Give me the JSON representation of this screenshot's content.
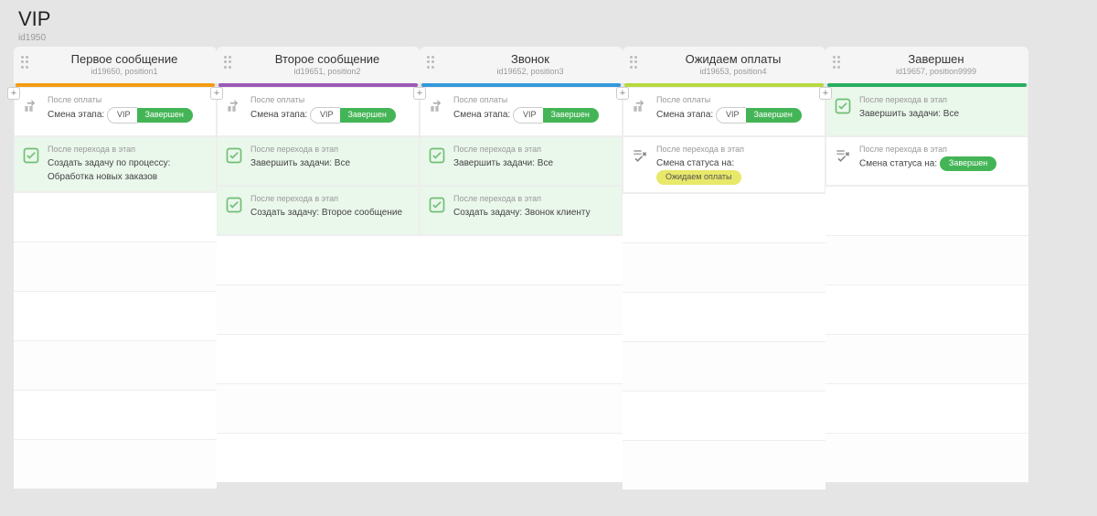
{
  "header": {
    "title": "VIP",
    "subtitle": "id1950"
  },
  "triggers": {
    "afterPay": "После оплаты",
    "afterStage": "После перехода в этап"
  },
  "labels": {
    "stageChange": "Смена этапа:",
    "createTaskProcess": "Создать задачу по процессу:",
    "completeTasks": "Завершить задачи:",
    "createTask": "Создать задачу:",
    "statusChange": "Смена статуса на:"
  },
  "pills": {
    "vip": "VIP",
    "done": "Завершен",
    "waiting": "Ожидаем оплаты"
  },
  "values": {
    "all": "Все",
    "processOrders": "Обработка новых заказов",
    "secondMsg": "Второе сообщение",
    "callClient": "Звонок клиенту"
  },
  "columns": [
    {
      "title": "Первое сообщение",
      "meta": "id19650, position1",
      "stripe": "s-orange"
    },
    {
      "title": "Второе сообщение",
      "meta": "id19651, position2",
      "stripe": "s-purple"
    },
    {
      "title": "Звонок",
      "meta": "id19652, position3",
      "stripe": "s-blue"
    },
    {
      "title": "Ожидаем оплаты",
      "meta": "id19653, position4",
      "stripe": "s-lime"
    },
    {
      "title": "Завершен",
      "meta": "id19657, position9999",
      "stripe": "s-green"
    }
  ]
}
